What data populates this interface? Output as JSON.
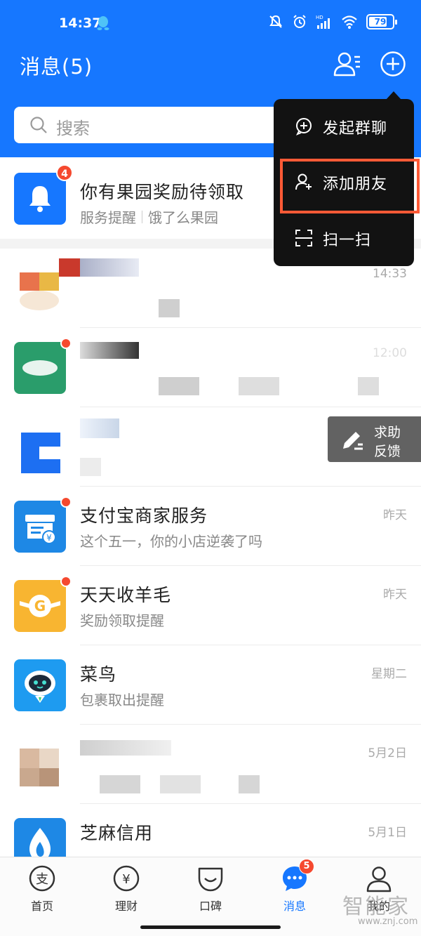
{
  "status_bar": {
    "time": "14:37",
    "battery": "79",
    "battery_level": 0.79
  },
  "header": {
    "title": "消息(5)",
    "search_placeholder": "搜索"
  },
  "notice": {
    "badge": "4",
    "title": "你有果园奖励待领取",
    "subtitle_a": "服务提醒",
    "subtitle_b": "饿了么果园"
  },
  "chats": [
    {
      "name": "",
      "preview": "",
      "time": "14:33"
    },
    {
      "name": "",
      "preview": "",
      "time": "12:00"
    },
    {
      "name": "",
      "preview": "",
      "time": ""
    },
    {
      "name": "支付宝商家服务",
      "preview": "这个五一，你的小店逆袭了吗",
      "time": "昨天"
    },
    {
      "name": "天天收羊毛",
      "preview": "奖励领取提醒",
      "time": "昨天"
    },
    {
      "name": "菜鸟",
      "preview": "包裹取出提醒",
      "time": "星期二"
    },
    {
      "name": "",
      "preview": "",
      "time": "5月2日"
    },
    {
      "name": "芝麻信用",
      "preview": "",
      "time": "5月1日"
    }
  ],
  "menu": {
    "items": [
      {
        "label": "发起群聊",
        "icon": "chat-plus-icon"
      },
      {
        "label": "添加朋友",
        "icon": "add-friend-icon"
      },
      {
        "label": "扫一扫",
        "icon": "scan-icon"
      }
    ]
  },
  "feedback": {
    "line1": "求助",
    "line2": "反馈"
  },
  "nav": {
    "items": [
      {
        "label": "首页",
        "icon": "alipay-home-icon"
      },
      {
        "label": "理财",
        "icon": "wealth-icon"
      },
      {
        "label": "口碑",
        "icon": "koubei-icon"
      },
      {
        "label": "消息",
        "icon": "message-icon",
        "badge": "5"
      },
      {
        "label": "我的",
        "icon": "profile-icon"
      }
    ]
  },
  "watermark": {
    "logo": "智能家",
    "url": "www.znj.com"
  },
  "colors": {
    "brand": "#1677ff",
    "badge": "#f5492f",
    "highlight": "#ff5a36"
  }
}
